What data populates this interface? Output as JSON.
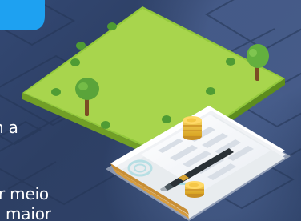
{
  "overlay_text": {
    "line_1": "n a",
    "line_2": "r meio",
    "line_3": "maior"
  },
  "colors": {
    "background": "#2f4166",
    "banner_blue": "#1ea1f1",
    "park_green": "#a4d24b",
    "park_edge": "#6f9f28",
    "tree_green": "#67b73a",
    "trunk": "#8b5a2b",
    "paper": "#fbfbfb",
    "coin": "#efba34",
    "pen": "#293136"
  },
  "icons": [
    "park-icon",
    "tree-icon",
    "document-stack-icon",
    "pen-icon",
    "coin-stack-icon",
    "stamp-icon"
  ]
}
